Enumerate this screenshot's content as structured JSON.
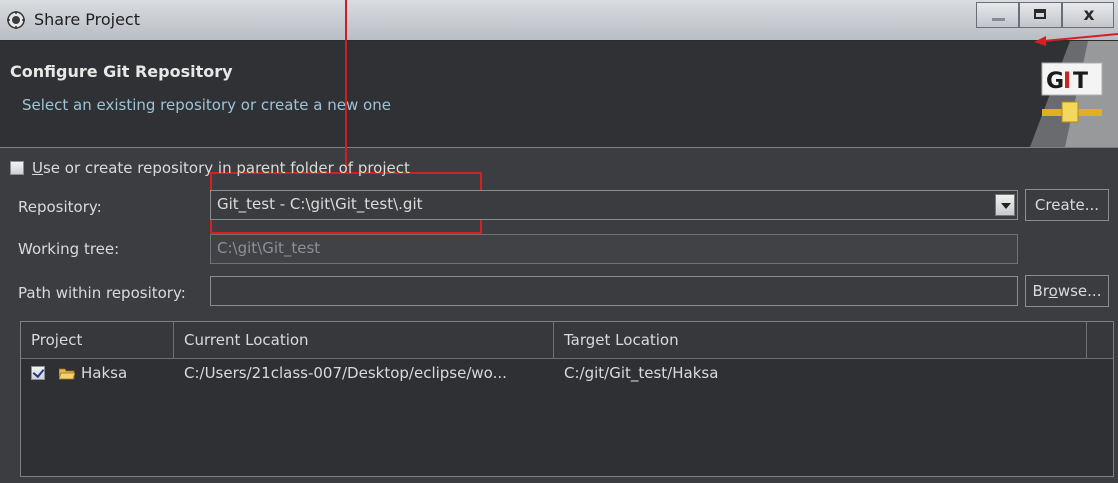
{
  "window": {
    "title": "Share Project",
    "buttons": {
      "minimize": "—",
      "maximize": "□",
      "close": "x"
    }
  },
  "header": {
    "title": "Configure Git Repository",
    "subtitle": "Select an existing repository or create a new one",
    "logo_text": "GIT"
  },
  "options": {
    "use_parent_label_prefix": "U",
    "use_parent_label_rest": "se or create repository in parent folder of project",
    "use_parent_checked": false
  },
  "form": {
    "repository_label": "Repository:",
    "repository_value": "Git_test - C:\\git\\Git_test\\.git",
    "create_button": "Create...",
    "working_tree_label": "Working tree:",
    "working_tree_value": "C:\\git\\Git_test",
    "path_label": "Path within repository:",
    "path_value": "",
    "browse_button_prefix": "Br",
    "browse_button_u": "o",
    "browse_button_rest": "wse..."
  },
  "table": {
    "columns": [
      "Project",
      "Current Location",
      "Target Location"
    ],
    "rows": [
      {
        "checked": true,
        "project": "Haksa",
        "current_location": "C:/Users/21class-007/Desktop/eclipse/wo...",
        "target_location": "C:/git/Git_test/Haksa"
      }
    ]
  },
  "colors": {
    "background": "#3b3d40",
    "annotation": "#d42020",
    "subtitle": "#9fc3d6"
  }
}
